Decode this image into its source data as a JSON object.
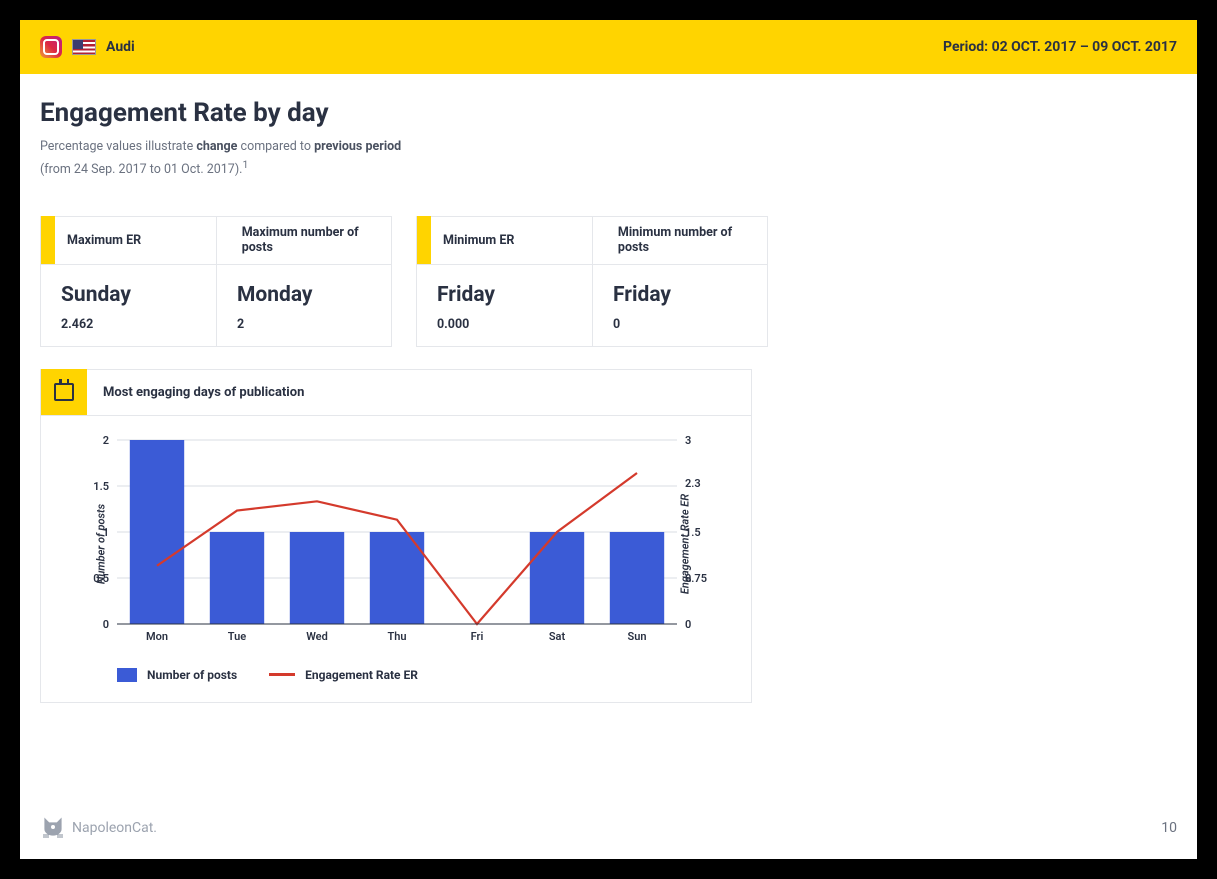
{
  "header": {
    "brand": "Audi",
    "period_label": "Period:",
    "period_dates": "02 OCT. 2017 – 09 OCT. 2017"
  },
  "title": "Engagement Rate by day",
  "subtitle_pre": "Percentage values illustrate ",
  "subtitle_b1": "change",
  "subtitle_mid": " compared to ",
  "subtitle_b2": "previous period",
  "subtitle_line2": "(from 24 Sep. 2017 to 01 Oct. 2017).",
  "subtitle_sup": "1",
  "kpis": [
    {
      "head": "Maximum ER",
      "day": "Sunday",
      "val": "2.462"
    },
    {
      "head": "Maximum number of posts",
      "day": "Monday",
      "val": "2"
    },
    {
      "head": "Minimum ER",
      "day": "Friday",
      "val": "0.000"
    },
    {
      "head": "Minimum number of posts",
      "day": "Friday",
      "val": "0"
    }
  ],
  "chart_panel_title": "Most engaging days of publication",
  "chart_data": {
    "type": "bar+line",
    "categories": [
      "Mon",
      "Tue",
      "Wed",
      "Thu",
      "Fri",
      "Sat",
      "Sun"
    ],
    "series": [
      {
        "name": "Number of posts",
        "kind": "bar",
        "axis": "left",
        "values": [
          2,
          1,
          1,
          1,
          0,
          1,
          1
        ]
      },
      {
        "name": "Engagement Rate ER",
        "kind": "line",
        "axis": "right",
        "values": [
          0.95,
          1.85,
          2.0,
          1.7,
          0.0,
          1.5,
          2.462
        ]
      }
    ],
    "ylabel_left": "Number of posts",
    "ylabel_right": "Engagement Rate ER",
    "ylim_left": [
      0,
      2
    ],
    "yticks_left": [
      0,
      0.5,
      1,
      1.5,
      2
    ],
    "ylim_right": [
      0,
      3
    ],
    "yticks_right": [
      0,
      0.75,
      1.5,
      2.3,
      3
    ],
    "legend": [
      "Number of posts",
      "Engagement Rate ER"
    ]
  },
  "footer_brand": "NapoleonCat.",
  "page_number": "10"
}
